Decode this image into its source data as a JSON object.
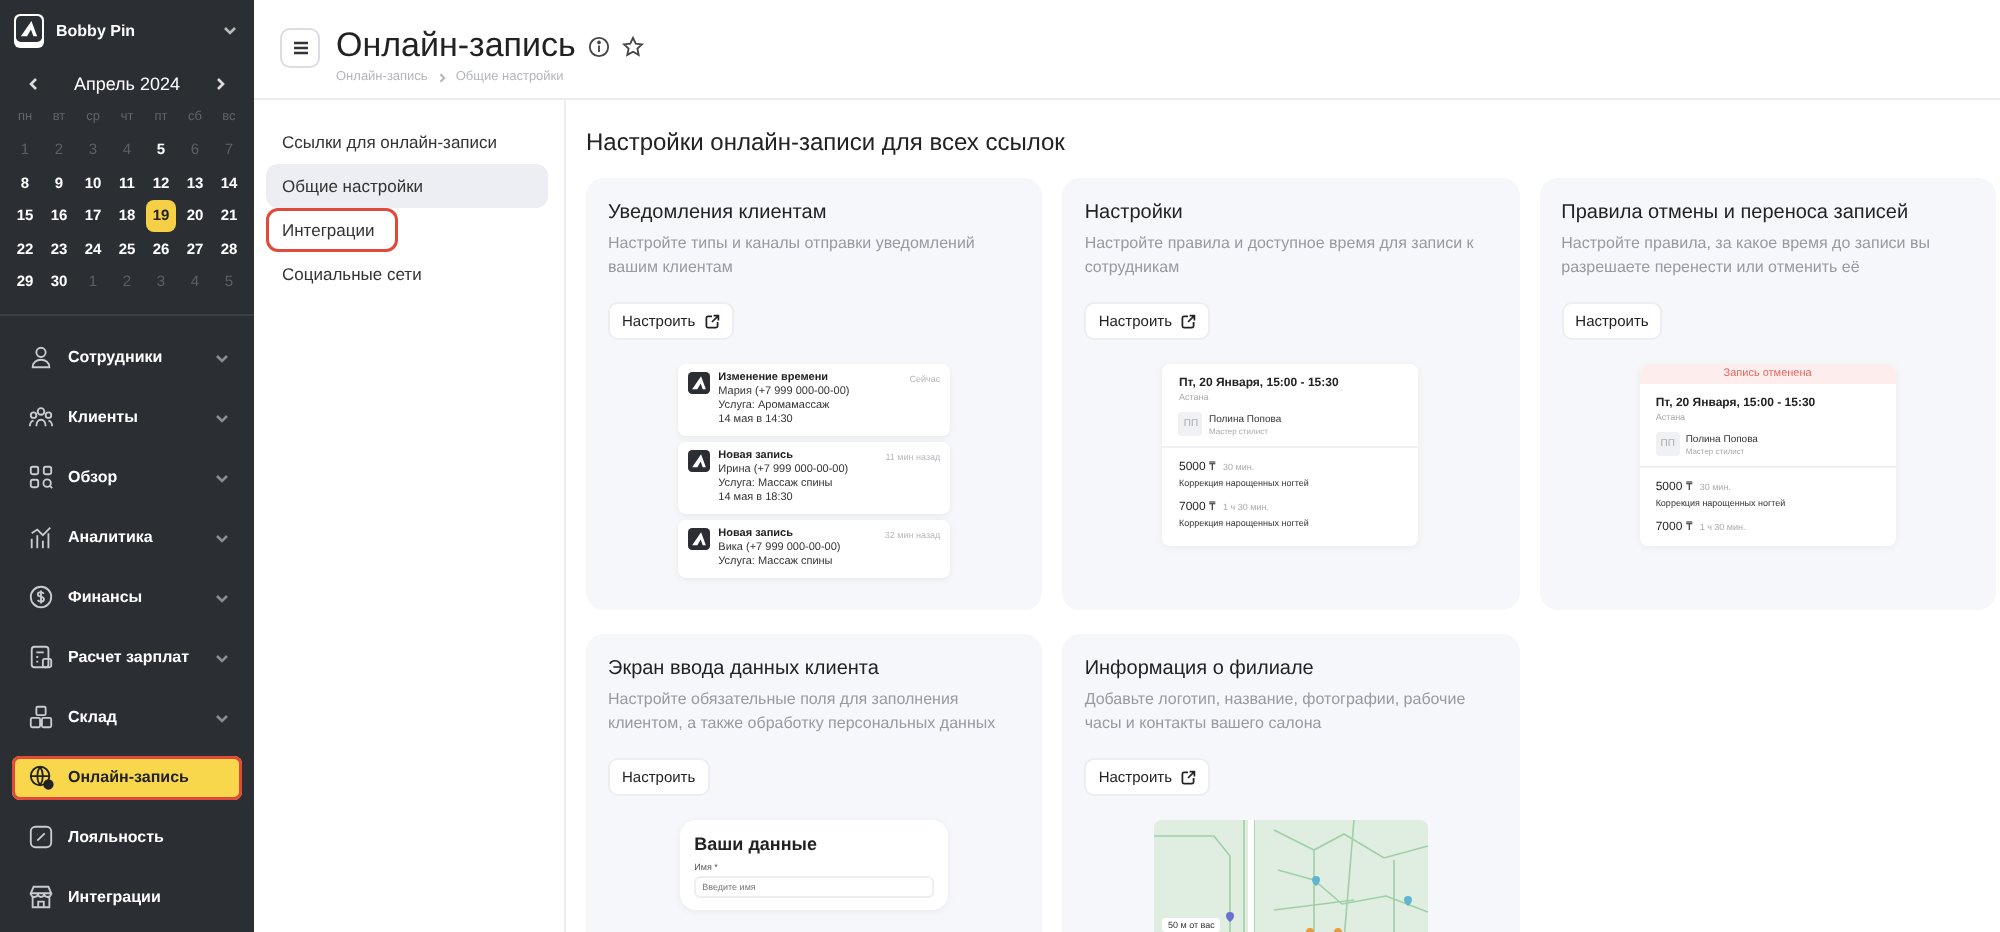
{
  "workspace": {
    "name": "Bobby Pin"
  },
  "calendar": {
    "month": "Апрель 2024",
    "weekdays": [
      "пн",
      "вт",
      "ср",
      "чт",
      "пт",
      "сб",
      "вс"
    ],
    "weeks": [
      [
        {
          "day": "1",
          "muted": true,
          "selected": false
        },
        {
          "day": "2",
          "muted": true,
          "selected": false
        },
        {
          "day": "3",
          "muted": true,
          "selected": false
        },
        {
          "day": "4",
          "muted": true,
          "selected": false
        },
        {
          "day": "5",
          "muted": false,
          "selected": false
        },
        {
          "day": "6",
          "muted": true,
          "selected": false
        },
        {
          "day": "7",
          "muted": true,
          "selected": false
        }
      ],
      [
        {
          "day": "8",
          "muted": false,
          "selected": false
        },
        {
          "day": "9",
          "muted": false,
          "selected": false
        },
        {
          "day": "10",
          "muted": false,
          "selected": false
        },
        {
          "day": "11",
          "muted": false,
          "selected": false
        },
        {
          "day": "12",
          "muted": false,
          "selected": false
        },
        {
          "day": "13",
          "muted": false,
          "selected": false
        },
        {
          "day": "14",
          "muted": false,
          "selected": false
        }
      ],
      [
        {
          "day": "15",
          "muted": false,
          "selected": false
        },
        {
          "day": "16",
          "muted": false,
          "selected": false
        },
        {
          "day": "17",
          "muted": false,
          "selected": false
        },
        {
          "day": "18",
          "muted": false,
          "selected": false
        },
        {
          "day": "19",
          "muted": false,
          "selected": true
        },
        {
          "day": "20",
          "muted": false,
          "selected": false
        },
        {
          "day": "21",
          "muted": false,
          "selected": false
        }
      ],
      [
        {
          "day": "22",
          "muted": false,
          "selected": false
        },
        {
          "day": "23",
          "muted": false,
          "selected": false
        },
        {
          "day": "24",
          "muted": false,
          "selected": false
        },
        {
          "day": "25",
          "muted": false,
          "selected": false
        },
        {
          "day": "26",
          "muted": false,
          "selected": false
        },
        {
          "day": "27",
          "muted": false,
          "selected": false
        },
        {
          "day": "28",
          "muted": false,
          "selected": false
        }
      ],
      [
        {
          "day": "29",
          "muted": false,
          "selected": false
        },
        {
          "day": "30",
          "muted": false,
          "selected": false
        },
        {
          "day": "1",
          "muted": true,
          "selected": false
        },
        {
          "day": "2",
          "muted": true,
          "selected": false
        },
        {
          "day": "3",
          "muted": true,
          "selected": false
        },
        {
          "day": "4",
          "muted": true,
          "selected": false
        },
        {
          "day": "5",
          "muted": true,
          "selected": false
        }
      ]
    ]
  },
  "nav": [
    {
      "label": "Сотрудники",
      "expandable": true,
      "selected": false,
      "outlined": false
    },
    {
      "label": "Клиенты",
      "expandable": true,
      "selected": false,
      "outlined": false
    },
    {
      "label": "Обзор",
      "expandable": true,
      "selected": false,
      "outlined": false
    },
    {
      "label": "Аналитика",
      "expandable": true,
      "selected": false,
      "outlined": false
    },
    {
      "label": "Финансы",
      "expandable": true,
      "selected": false,
      "outlined": false
    },
    {
      "label": "Расчет зарплат",
      "expandable": true,
      "selected": false,
      "outlined": false
    },
    {
      "label": "Склад",
      "expandable": true,
      "selected": false,
      "outlined": false
    },
    {
      "label": "Онлайн-запись",
      "expandable": false,
      "selected": true,
      "outlined": true
    },
    {
      "label": "Лояльность",
      "expandable": false,
      "selected": false,
      "outlined": false
    },
    {
      "label": "Интеграции",
      "expandable": false,
      "selected": false,
      "outlined": false
    }
  ],
  "header": {
    "title": "Онлайн-запись",
    "breadcrumbs": [
      "Онлайн-запись",
      "Общие настройки"
    ]
  },
  "subnav": [
    {
      "label": "Ссылки для онлайн-записи",
      "selected": false,
      "outlined": false
    },
    {
      "label": "Общие настройки",
      "selected": true,
      "outlined": false
    },
    {
      "label": "Интеграции",
      "selected": false,
      "outlined": true
    },
    {
      "label": "Социальные сети",
      "selected": false,
      "outlined": false
    }
  ],
  "section_title": "Настройки онлайн-записи для всех ссылок",
  "cards": [
    {
      "title": "Уведомления клиентам",
      "description": "Настройте типы и каналы отправки уведомлений вашим клиентам",
      "button": {
        "label": "Настроить",
        "external": true
      },
      "preview": {
        "kind": "notifications",
        "items": [
          {
            "title": "Изменение времени",
            "time": "Сейчас",
            "lines": [
              "Мария (+7 999 000-00-00)",
              "Услуга: Аромамассаж",
              "14 мая в 14:30"
            ]
          },
          {
            "title": "Новая запись",
            "time": "11 мин назад",
            "lines": [
              "Ирина (+7 999 000-00-00)",
              "Услуга: Массаж спины",
              "14 мая в 18:30"
            ]
          },
          {
            "title": "Новая запись",
            "time": "32 мин назад",
            "lines": [
              "Вика (+7 999 000-00-00)",
              "Услуга: Массаж спины"
            ]
          }
        ]
      }
    },
    {
      "title": "Настройки",
      "description": "Настройте правила и доступное время для записи к сотрудникам",
      "button": {
        "label": "Настроить",
        "external": true
      },
      "preview": {
        "kind": "appointment",
        "date": "Пт, 20 Января, 15:00 - 15:30",
        "city": "Астана",
        "initials": "ПП",
        "master": "Полина Попова",
        "role": "Мастер стилист",
        "services": [
          {
            "price": "5000 ₸",
            "duration": "30 мин.",
            "name": "Коррекция нарощенных ногтей"
          },
          {
            "price": "7000 ₸",
            "duration": "1 ч 30 мин.",
            "name": "Коррекция нарощенных ногтей"
          }
        ]
      }
    },
    {
      "title": "Правила отмены и переноса записей",
      "description": "Настройте правила, за какое время до записи вы разрешаете перенести или отменить её",
      "button": {
        "label": "Настроить",
        "external": false
      },
      "preview": {
        "kind": "appointment",
        "banner": "Запись отменена",
        "date": "Пт, 20 Января, 15:00 - 15:30",
        "city": "Астана",
        "initials": "ПП",
        "master": "Полина Попова",
        "role": "Мастер стилист",
        "services": [
          {
            "price": "5000 ₸",
            "duration": "30 мин.",
            "name": "Коррекция нарощенных ногтей"
          },
          {
            "price": "7000 ₸",
            "duration": "1 ч 30 мин."
          }
        ]
      }
    },
    {
      "title": "Экран ввода данных клиента",
      "description": "Настройте обязательные поля для заполнения клиентом, а также обработку персональных данных",
      "button": {
        "label": "Настроить",
        "external": false
      },
      "preview": {
        "kind": "form",
        "title": "Ваши данные",
        "label": "Имя *",
        "placeholder": "Введите имя"
      }
    },
    {
      "title": "Информация о филиале",
      "description": "Добавьте логотип, название, фотографии, рабочие часы и контакты вашего салона",
      "button": {
        "label": "Настроить",
        "external": true
      },
      "preview": {
        "kind": "map",
        "distance": "50 м от вас"
      }
    }
  ]
}
